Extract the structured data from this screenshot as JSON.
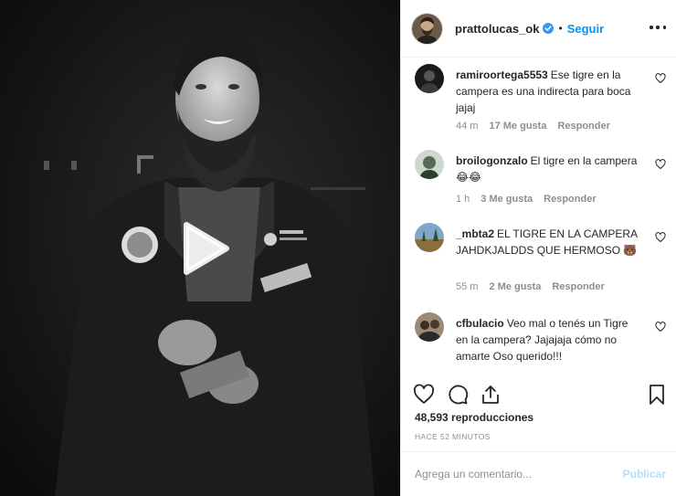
{
  "post": {
    "username": "prattolucas_ok",
    "verified": true,
    "dot": "•",
    "follow_label": "Seguir",
    "views": "48,593 reproducciones",
    "time_ago": "hace 52 minutos"
  },
  "comments": [
    {
      "user": "ramiroortega5553",
      "text": "Ese tigre en la campera es una indirecta para boca jajaj",
      "time": "44 m",
      "likes": "17 Me gusta",
      "reply": "Responder"
    },
    {
      "user": "broilogonzalo",
      "text": "El tigre en la campera 😂😂",
      "time": "1 h",
      "likes": "3 Me gusta",
      "reply": "Responder"
    },
    {
      "user": "_mbta2",
      "text": "EL TIGRE EN LA CAMPERA JAHDKJALDDS QUE HERMOSO 🐻",
      "time": "55 m",
      "likes": "2 Me gusta",
      "reply": "Responder"
    },
    {
      "user": "cfbulacio",
      "text": "Veo mal o tenés un Tigre en la campera? Jajajaja cómo no amarte Oso querido!!!",
      "time": "",
      "likes": "",
      "reply": ""
    }
  ],
  "add_comment": {
    "placeholder": "Agrega un comentario...",
    "publish_label": "Publicar"
  },
  "icons": {
    "like": "heart-icon",
    "comment": "comment-icon",
    "share": "share-icon",
    "save": "bookmark-icon",
    "more": "more-options-icon",
    "play": "play-icon",
    "verified": "verified-badge-icon"
  },
  "colors": {
    "link_blue": "#0095f6",
    "publish_disabled": "#b2dffc",
    "muted": "#8e8e8e",
    "text": "#262626",
    "verified": "#3897f0"
  }
}
